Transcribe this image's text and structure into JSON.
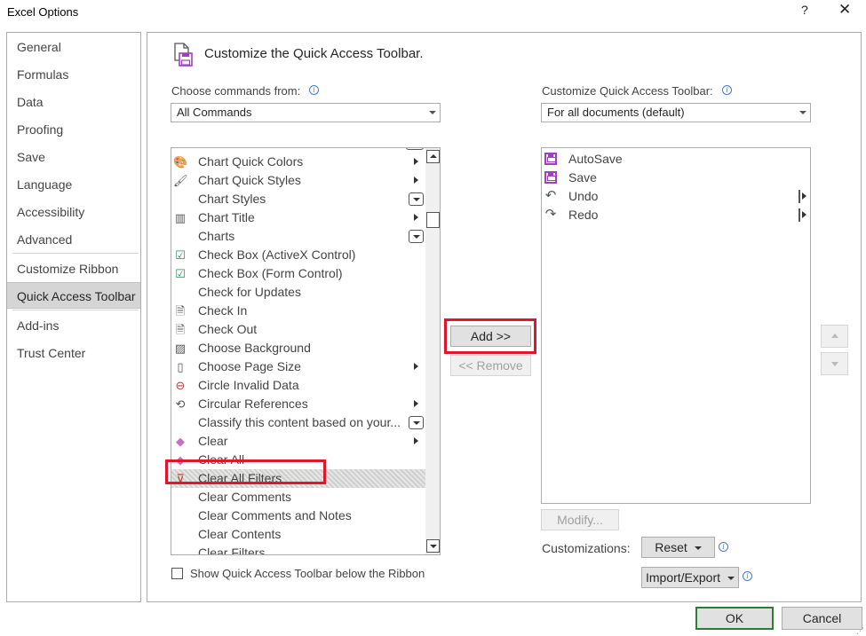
{
  "window": {
    "title": "Excel Options",
    "help": "?",
    "close": "✕"
  },
  "nav": {
    "items": [
      "General",
      "Formulas",
      "Data",
      "Proofing",
      "Save",
      "Language",
      "Accessibility",
      "Advanced",
      "Customize Ribbon",
      "Quick Access Toolbar",
      "Add-ins",
      "Trust Center"
    ],
    "active": "Quick Access Toolbar"
  },
  "header": {
    "title": "Customize the Quick Access Toolbar."
  },
  "left_pane": {
    "choose_label": "Choose commands from:",
    "choose_value": "All Commands",
    "commands": [
      {
        "label": "Chart Quick Colors",
        "icon": "palette-icon",
        "glyph": "🎨",
        "marker": "submenu"
      },
      {
        "label": "Chart Quick Styles",
        "icon": "brush-icon",
        "glyph": "🖌",
        "marker": "submenu"
      },
      {
        "label": "Chart Styles",
        "icon": "",
        "glyph": "",
        "marker": "dropdown"
      },
      {
        "label": "Chart Title",
        "icon": "chart-title-icon",
        "glyph": "▥",
        "marker": "submenu"
      },
      {
        "label": "Charts",
        "icon": "",
        "glyph": "",
        "marker": "dropdown"
      },
      {
        "label": "Check Box (ActiveX Control)",
        "icon": "checkbox-icon",
        "glyph": "☑",
        "marker": ""
      },
      {
        "label": "Check Box (Form Control)",
        "icon": "checkbox-icon",
        "glyph": "☑",
        "marker": ""
      },
      {
        "label": "Check for Updates",
        "icon": "",
        "glyph": "",
        "marker": ""
      },
      {
        "label": "Check In",
        "icon": "check-in-icon",
        "glyph": "🗎",
        "marker": ""
      },
      {
        "label": "Check Out",
        "icon": "check-out-icon",
        "glyph": "🗎",
        "marker": ""
      },
      {
        "label": "Choose Background",
        "icon": "picture-icon",
        "glyph": "▨",
        "marker": ""
      },
      {
        "label": "Choose Page Size",
        "icon": "page-size-icon",
        "glyph": "▯",
        "marker": "submenu"
      },
      {
        "label": "Circle Invalid Data",
        "icon": "circle-invalid-icon",
        "glyph": "⊖",
        "marker": ""
      },
      {
        "label": "Circular References",
        "icon": "circular-ref-icon",
        "glyph": "⟲",
        "marker": "submenu"
      },
      {
        "label": "Classify this content based on your...",
        "icon": "",
        "glyph": "",
        "marker": "dropdown"
      },
      {
        "label": "Clear",
        "icon": "eraser-icon",
        "glyph": "◆",
        "marker": "submenu"
      },
      {
        "label": "Clear All",
        "icon": "eraser-icon",
        "glyph": "◆",
        "marker": ""
      },
      {
        "label": "Clear All Filters",
        "icon": "clear-filter-icon",
        "glyph": "⊽",
        "marker": "",
        "selected": true
      },
      {
        "label": "Clear Comments",
        "icon": "",
        "glyph": "",
        "marker": ""
      },
      {
        "label": "Clear Comments and Notes",
        "icon": "",
        "glyph": "",
        "marker": ""
      },
      {
        "label": "Clear Contents",
        "icon": "",
        "glyph": "",
        "marker": ""
      },
      {
        "label": "Clear Filters",
        "icon": "",
        "glyph": "",
        "marker": ""
      }
    ],
    "show_below_label": "Show Quick Access Toolbar below the Ribbon",
    "show_below_checked": false
  },
  "middle": {
    "add_label": "Add >>",
    "remove_label": "<< Remove"
  },
  "right_pane": {
    "customize_label": "Customize Quick Access Toolbar:",
    "customize_value": "For all documents (default)",
    "items": [
      {
        "label": "AutoSave",
        "icon": "save-icon",
        "glyph": "",
        "separator": false
      },
      {
        "label": "Save",
        "icon": "save-icon",
        "glyph": "",
        "separator": false
      },
      {
        "label": "Undo",
        "icon": "undo-icon",
        "glyph": "↶",
        "separator": true
      },
      {
        "label": "Redo",
        "icon": "redo-icon",
        "glyph": "↷",
        "separator": true
      }
    ],
    "modify_label": "Modify...",
    "customizations_label": "Customizations:",
    "reset_label": "Reset",
    "import_export_label": "Import/Export"
  },
  "footer": {
    "ok_label": "OK",
    "cancel_label": "Cancel"
  },
  "colors": {
    "highlight": "#e0162b",
    "save_icon": "#a03fc4",
    "ok_border": "#2e7d32"
  }
}
